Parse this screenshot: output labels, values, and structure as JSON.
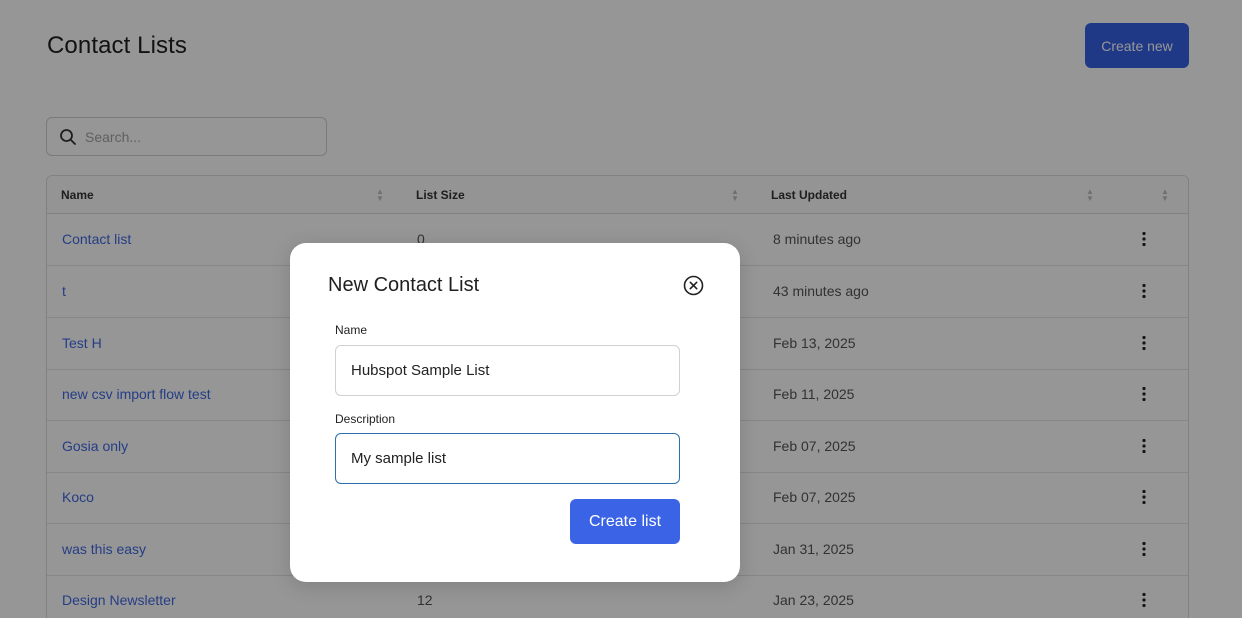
{
  "page": {
    "title": "Contact Lists",
    "create_new_label": "Create new",
    "accent_color": "#3561e6"
  },
  "search": {
    "placeholder": "Search...",
    "value": "",
    "icon": "search-icon"
  },
  "table": {
    "columns": [
      "Name",
      "List Size",
      "Last Updated",
      ""
    ],
    "rows": [
      {
        "name": "Contact list",
        "size": "0",
        "updated": "8 minutes ago"
      },
      {
        "name": "t",
        "size": "",
        "updated": "43 minutes ago"
      },
      {
        "name": "Test H",
        "size": "",
        "updated": "Feb 13, 2025"
      },
      {
        "name": "new csv import flow test",
        "size": "",
        "updated": "Feb 11, 2025"
      },
      {
        "name": "Gosia only",
        "size": "",
        "updated": "Feb 07, 2025"
      },
      {
        "name": "Koco",
        "size": "",
        "updated": "Feb 07, 2025"
      },
      {
        "name": "was this easy",
        "size": "",
        "updated": "Jan 31, 2025"
      },
      {
        "name": "Design Newsletter",
        "size": "12",
        "updated": "Jan 23, 2025"
      }
    ],
    "row_action_icon": "kebab-menu-icon"
  },
  "modal": {
    "title": "New Contact List",
    "close_icon": "close-circle-icon",
    "name_label": "Name",
    "name_value": "Hubspot Sample List",
    "description_label": "Description",
    "description_value": "My sample list",
    "submit_label": "Create list"
  }
}
